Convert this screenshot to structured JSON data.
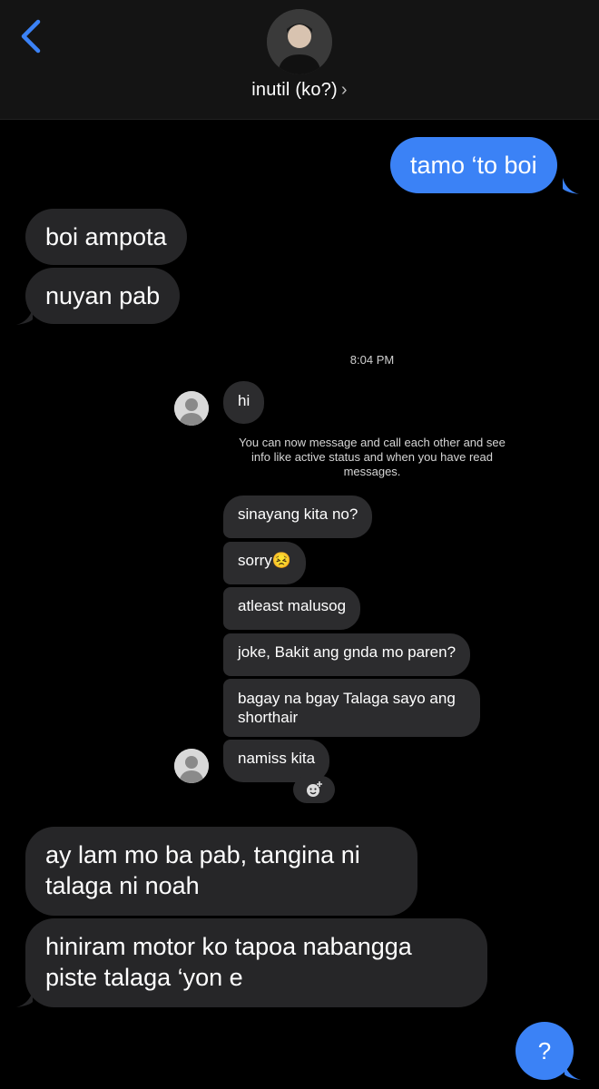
{
  "header": {
    "contact_name": "inutil (ko?)",
    "chevron": "›",
    "back_icon": "chevron-left-icon"
  },
  "messages": {
    "outgoing_1": "tamo ‘to boi",
    "incoming_1": "boi ampota",
    "incoming_2": "nuyan pab",
    "incoming_3": "ay lam mo ba pab, tangina ni talaga ni noah",
    "incoming_4": "hiniram motor ko tapoa nabangga piste talaga ‘yon e"
  },
  "embedded_chat": {
    "time": "8:04 PM",
    "hi": "hi",
    "notice": "You can now message and call each other and see info like active status and when you have read messages.",
    "msgs": [
      "sinayang kita no?",
      "sorry😣",
      "atleast malusog",
      "joke, Bakit ang gnda mo paren?",
      "bagay na bgay Talaga sayo ang shorthair",
      "namiss kita"
    ]
  },
  "help": {
    "label": "?"
  },
  "colors": {
    "accent": "#3b82f6",
    "incoming_bubble": "#262628",
    "background": "#000000"
  }
}
